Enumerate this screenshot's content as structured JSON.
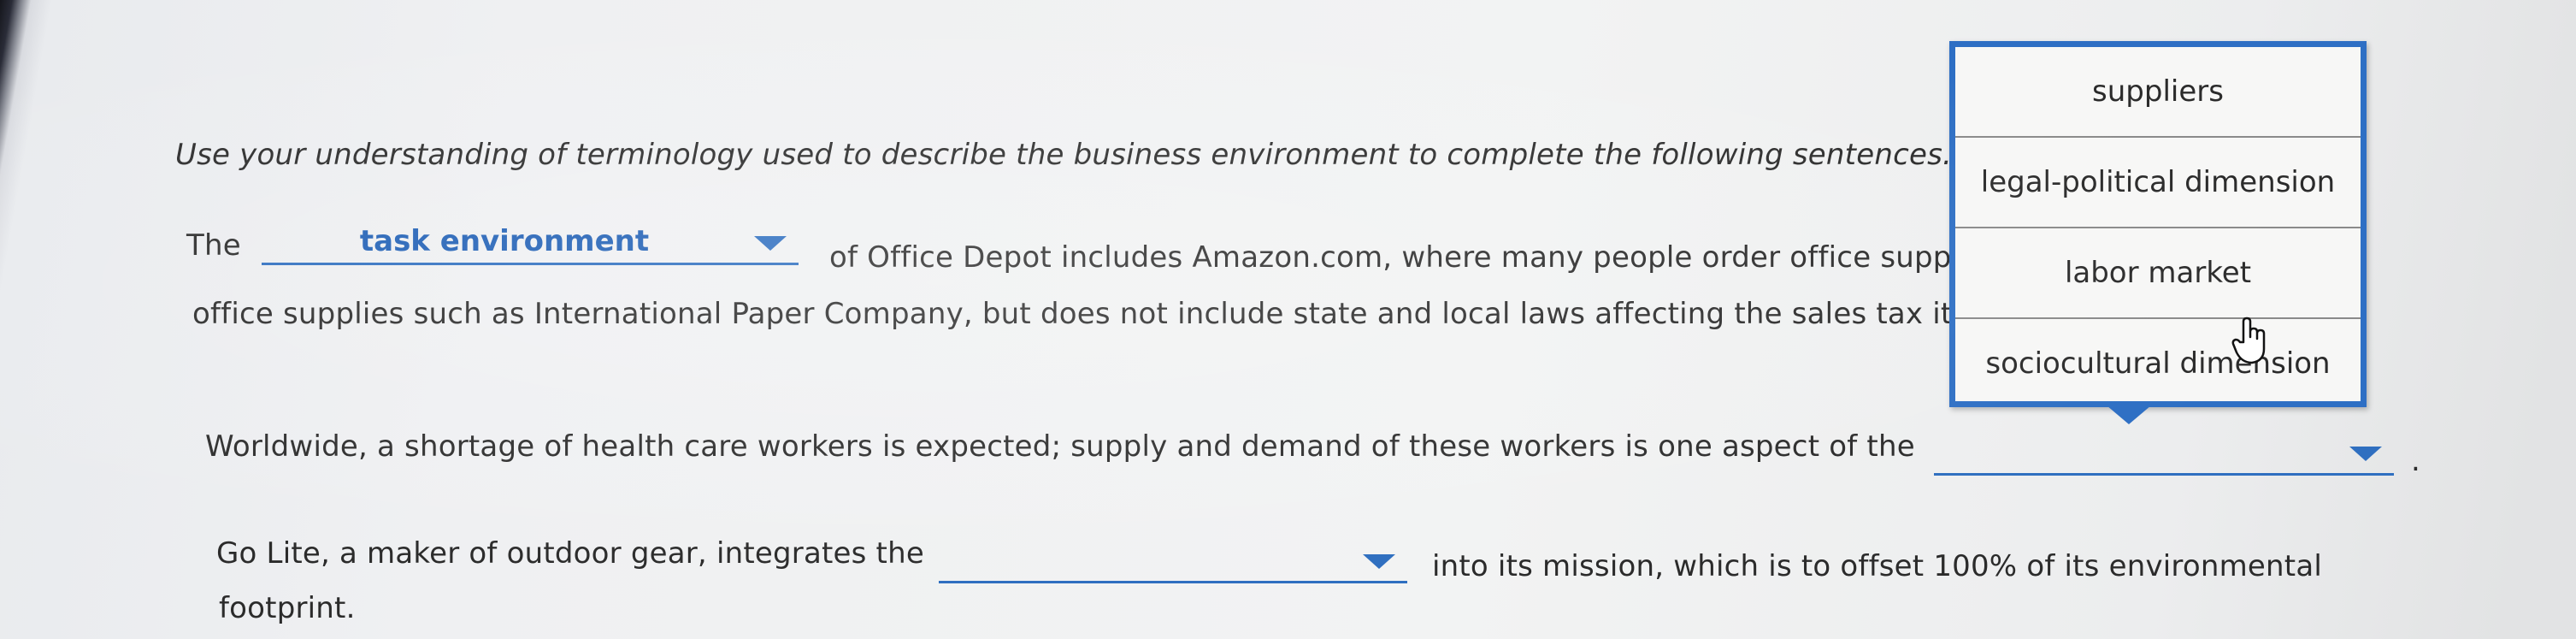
{
  "instructions": "Use your understanding of terminology used to describe the business environment to complete the following sentences.",
  "q1": {
    "prefix": "The",
    "selected": "task environment",
    "line1_after": "of Office Depot includes Amazon.com, where many people order office supplies, and suppliers of",
    "line2": "office supplies such as International Paper Company, but does not include state and local laws affecting the sales tax it pays."
  },
  "q2": {
    "text": "Worldwide, a shortage of health care workers is expected; supply and demand of these workers is one aspect of the",
    "selected": "",
    "suffix": "."
  },
  "q3": {
    "before": "Go Lite, a maker of outdoor gear, integrates the",
    "selected": "",
    "after": "into its mission, which is to offset 100% of its environmental",
    "line2": "footprint."
  },
  "dropdown_menu": {
    "options": [
      "suppliers",
      "legal-political dimension",
      "labor market",
      "sociocultural dimension"
    ],
    "accent_color": "#2e6fc4"
  },
  "colors": {
    "dropdown_text": "#1f5fb5",
    "dropdown_underline": "#2f6fc0",
    "body_text": "#2b2b2b"
  }
}
